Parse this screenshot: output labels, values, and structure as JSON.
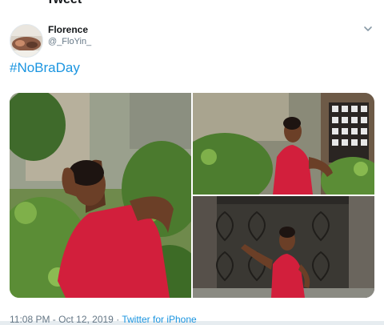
{
  "header": {
    "title": "Tweet"
  },
  "tweet": {
    "author_name": "Florence",
    "author_handle": "@_FloYin_",
    "text": "#NoBraDay",
    "timestamp": "11:08 PM - Oct 12, 2019",
    "separator": " · ",
    "source": "Twitter for iPhone"
  },
  "icons": {
    "menu": "chevron-down-icon",
    "avatar": "avatar-photo"
  },
  "colors": {
    "link": "#1b95e0",
    "text": "#14171a",
    "muted": "#657786",
    "dress": "#d21f3c"
  }
}
